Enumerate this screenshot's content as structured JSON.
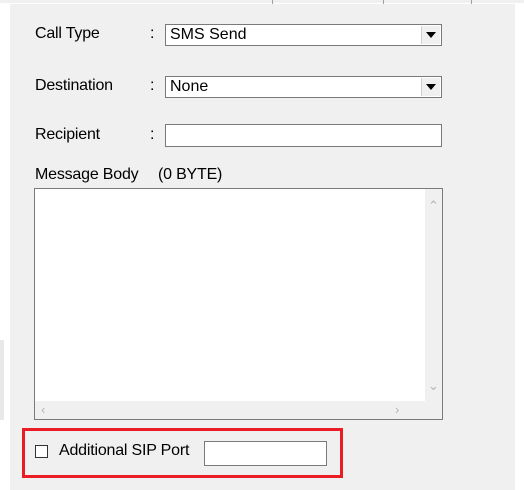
{
  "form": {
    "call_type": {
      "label": "Call Type",
      "colon": ":",
      "value": "SMS Send"
    },
    "destination": {
      "label": "Destination",
      "colon": ":",
      "value": "None"
    },
    "recipient": {
      "label": "Recipient",
      "colon": ":",
      "value": ""
    },
    "message_body": {
      "label": "Message Body",
      "size_label": "(0 BYTE)",
      "value": ""
    },
    "additional_sip_port": {
      "label": "Additional SIP Port",
      "checked": false,
      "value": ""
    }
  },
  "icons": {
    "dropdown": "chevron-down-icon",
    "scroll_up": "scroll-up-arrow-icon",
    "scroll_down": "scroll-down-arrow-icon",
    "scroll_left": "scroll-left-arrow-icon",
    "scroll_right": "scroll-right-arrow-icon"
  },
  "colors": {
    "highlight": "#ea1c24",
    "panel": "#f0f0f0"
  }
}
